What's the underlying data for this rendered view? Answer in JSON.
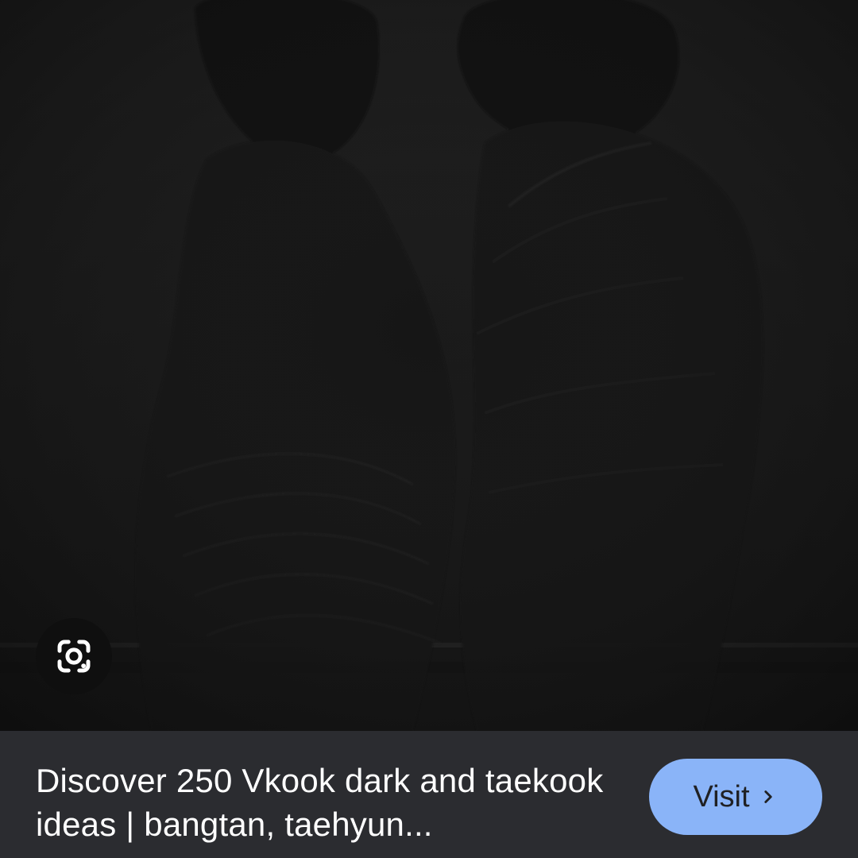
{
  "image_preview": {
    "alt": "Vkook dark image preview"
  },
  "lens": {
    "icon": "google-lens-icon"
  },
  "caption": {
    "title": "Discover 250 Vkook dark and taekook ideas | bangtan, taehyun..."
  },
  "visit_button": {
    "label": "Visit",
    "icon": "chevron-right-icon"
  },
  "colors": {
    "background": "#202124",
    "caption_bar": "#2b2c30",
    "visit_button": "#8ab4f8",
    "text": "#ffffff"
  }
}
